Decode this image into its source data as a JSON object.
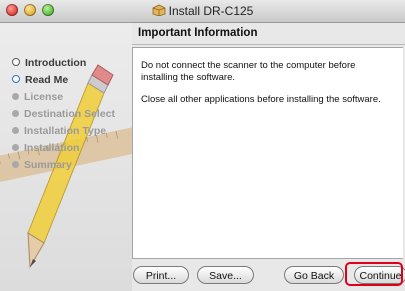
{
  "window": {
    "title": "Install DR-C125"
  },
  "heading": "Important Information",
  "sidebar": {
    "steps": [
      {
        "label": "Introduction",
        "state": "done"
      },
      {
        "label": "Read Me",
        "state": "current"
      },
      {
        "label": "License",
        "state": "pending"
      },
      {
        "label": "Destination Select",
        "state": "pending"
      },
      {
        "label": "Installation Type",
        "state": "pending"
      },
      {
        "label": "Installation",
        "state": "pending"
      },
      {
        "label": "Summary",
        "state": "pending"
      }
    ]
  },
  "content": {
    "paragraphs": [
      "Do not connect the scanner to the computer before installing the software.",
      "Close all other applications before installing the software."
    ]
  },
  "buttons": {
    "print": "Print...",
    "save": "Save...",
    "go_back": "Go Back",
    "continue": "Continue"
  },
  "colors": {
    "highlight": "#e0001a",
    "current_step": "#2b6fd6"
  }
}
